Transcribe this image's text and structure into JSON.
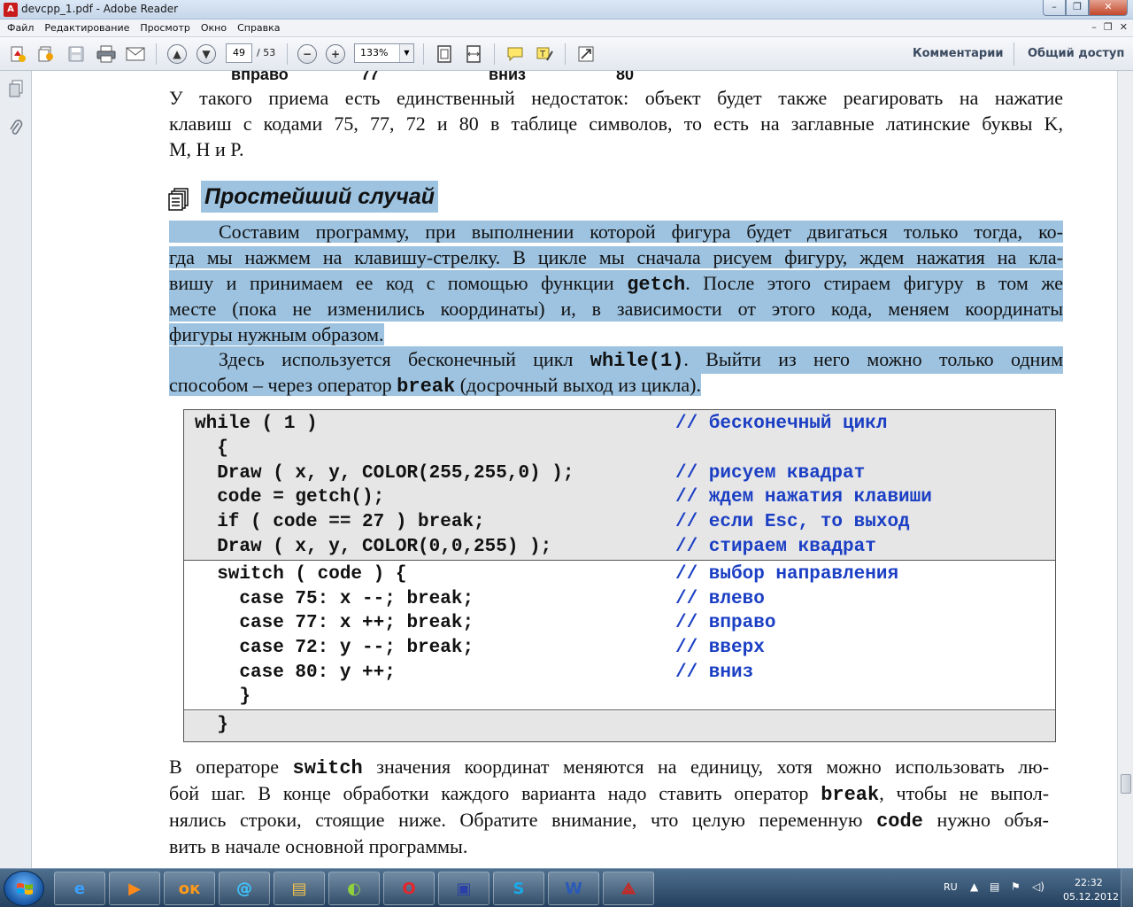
{
  "window": {
    "title": "devcpp_1.pdf - Adobe Reader",
    "app_glyph": "A"
  },
  "menu": [
    "Файл",
    "Редактирование",
    "Просмотр",
    "Окно",
    "Справка"
  ],
  "toolbar": {
    "page_current": "49",
    "page_total": "/ 53",
    "zoom": "133%",
    "comments_label": "Комментарии",
    "share_label": "Общий доступ"
  },
  "doc": {
    "prev_row": [
      "вправо",
      "77",
      "вниз",
      "80"
    ],
    "para1": [
      "У такого приема есть единственный недостаток: объект будет также реагировать на нажатие",
      "клавиш с кодами 75, 77, 72 и 80 в таблице символов, то есть на заглавные латинские буквы K,",
      "M, H и P."
    ],
    "heading": "Простейший случай",
    "para2": {
      "l1": "Составим программу, при выполнении которой фигура будет двигаться только тогда, ко-",
      "l2": "гда мы нажмем на клавишу-стрелку. В цикле мы сначала рисуем фигуру, ждем нажатия на кла-",
      "l3a": "вишу и принимаем ее код с помощью функции",
      "l3code": "getch",
      "l3b": ". После этого стираем фигуру в том же",
      "l4": "месте (пока не изменились координаты) и, в зависимости от этого кода, меняем координаты",
      "l5": "фигуры нужным образом."
    },
    "para3": {
      "l1a": "Здесь используется бесконечный цикл",
      "l1code": "while(1)",
      "l1b": ". Выйти из него можно только одним",
      "l2a": "способом – через оператор",
      "l2code": "break",
      "l2b": "(досрочный выход из цикла)."
    },
    "code": [
      {
        "code": "while ( 1 )",
        "comment": "// бесконечный цикл"
      },
      {
        "code": "  {",
        "comment": ""
      },
      {
        "code": "  Draw ( x, y, COLOR(255,255,0) );",
        "comment": "// рисуем квадрат"
      },
      {
        "code": "  code = getch();",
        "comment": "// ждем нажатия клавиши"
      },
      {
        "code": "  if ( code == 27 ) break;",
        "comment": "// если Esc, то выход"
      },
      {
        "code": "  Draw ( x, y, COLOR(0,0,255) );",
        "comment": "// стираем квадрат"
      },
      {
        "code": "  switch ( code ) {",
        "comment": "// выбор направления"
      },
      {
        "code": "    case 75: x --; break;",
        "comment": "// влево"
      },
      {
        "code": "    case 77: x ++; break;",
        "comment": "// вправо"
      },
      {
        "code": "    case 72: y --; break;",
        "comment": "// вверх"
      },
      {
        "code": "    case 80: y ++;",
        "comment": "// вниз"
      },
      {
        "code": "    }",
        "comment": ""
      },
      {
        "code": "  }",
        "comment": ""
      }
    ],
    "para4": {
      "l1a": "В операторе",
      "l1code": "switch",
      "l1b": "значения координат меняются на единицу, хотя можно использовать лю-",
      "l2a": "бой шаг. В конце обработки каждого варианта надо ставить оператор",
      "l2code": "break",
      "l2b": ", чтобы не выпол-",
      "l3a": "нялись строки, стоящие ниже. Обратите внимание, что целую переменную",
      "l3code": "code",
      "l3b": "нужно объя-",
      "l4": "вить в начале основной программы."
    }
  },
  "taskbar": {
    "apps": [
      {
        "name": "ie",
        "glyph": "e",
        "color": "#3aa0ff"
      },
      {
        "name": "media",
        "glyph": "▶",
        "color": "#ff8a1a"
      },
      {
        "name": "odnoklassniki",
        "glyph": "ок",
        "color": "#ff9a1a"
      },
      {
        "name": "mail-agent",
        "glyph": "@",
        "color": "#3ec5ff"
      },
      {
        "name": "explorer",
        "glyph": "▤",
        "color": "#f2c34c"
      },
      {
        "name": "games",
        "glyph": "◐",
        "color": "#8fd13c"
      },
      {
        "name": "opera",
        "glyph": "O",
        "color": "#e4262b"
      },
      {
        "name": "save",
        "glyph": "▣",
        "color": "#2a3fa8"
      },
      {
        "name": "skype",
        "glyph": "S",
        "color": "#19a9e8"
      },
      {
        "name": "word",
        "glyph": "W",
        "color": "#2a5ab8"
      },
      {
        "name": "adobe-reader",
        "glyph": "⟁",
        "color": "#d1231c"
      }
    ],
    "lang": "RU",
    "time": "22:32",
    "date": "05.12.2012"
  }
}
